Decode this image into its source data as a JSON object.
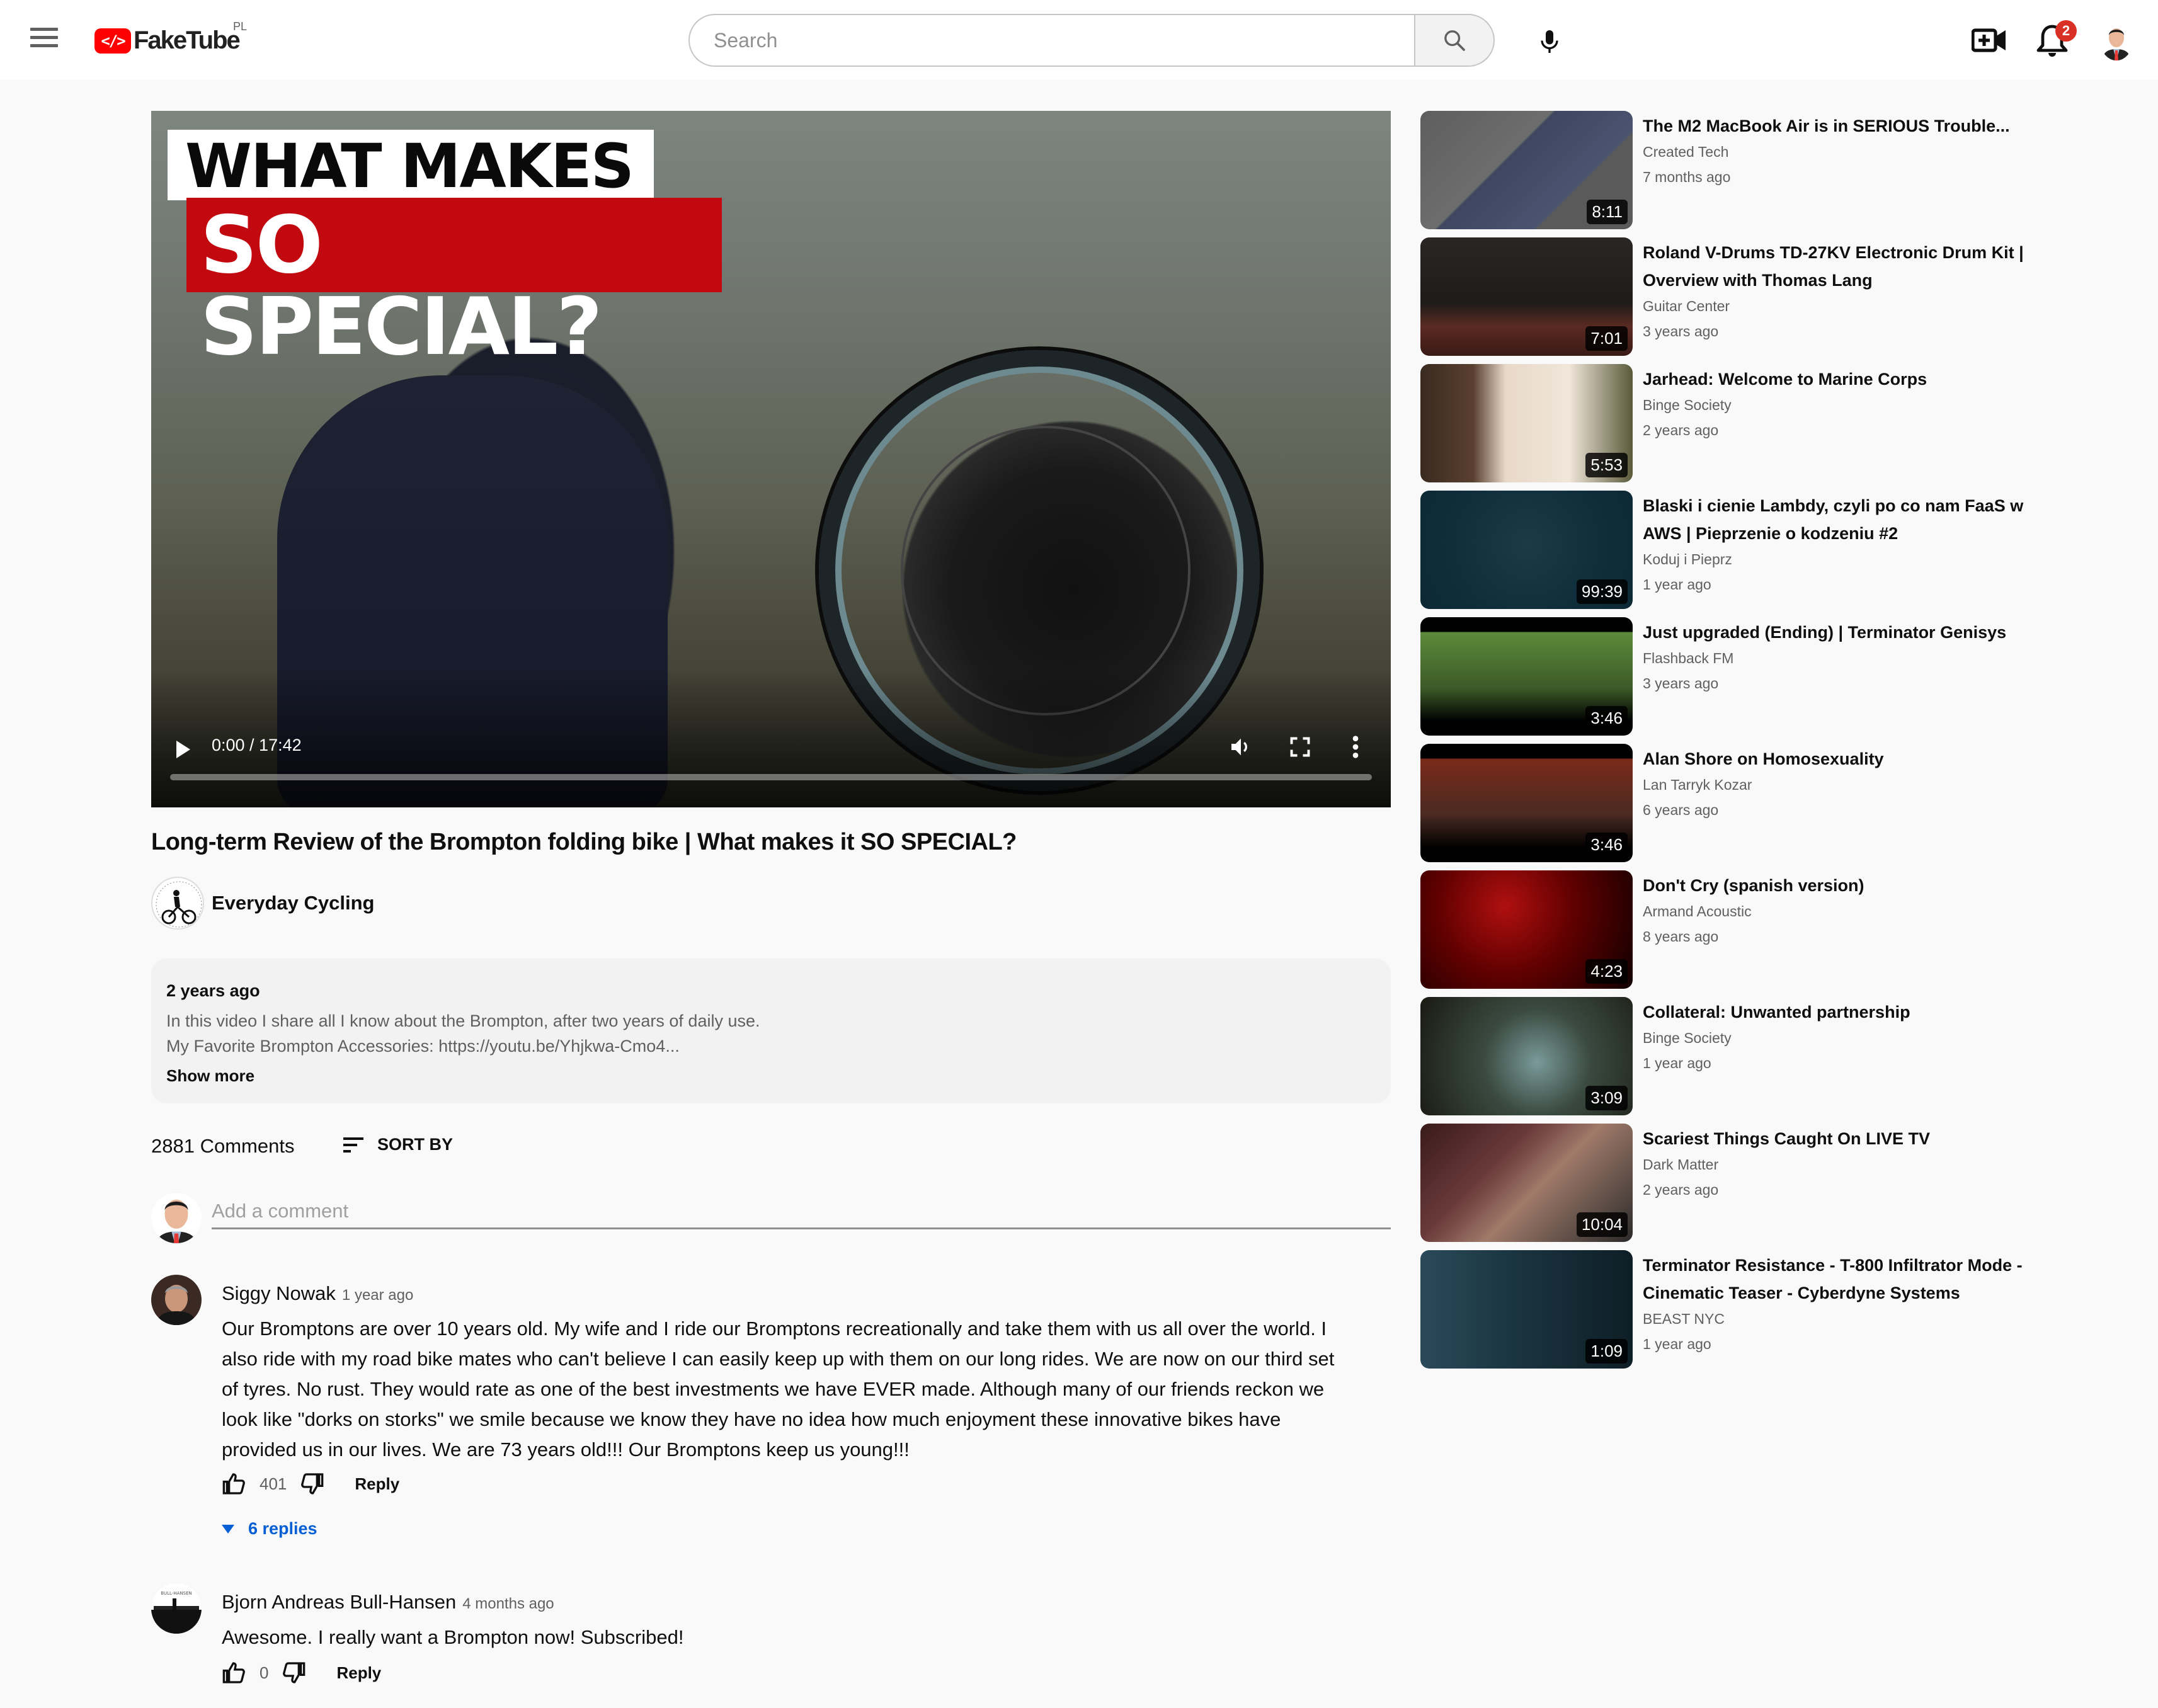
{
  "header": {
    "app_name": "FakeTube",
    "country_code": "PL",
    "search_placeholder": "Search",
    "search_value": "",
    "notification_count": "2"
  },
  "player": {
    "thumbnail_line1": "WHAT MAKES IT",
    "thumbnail_line2": "SO SPECIAL?",
    "time_display": "0:00 / 17:42",
    "progress_fraction": 0
  },
  "video": {
    "title": "Long-term Review of the Brompton folding bike | What makes it SO SPECIAL?",
    "channel_name": "Everyday Cycling"
  },
  "description": {
    "date": "2 years ago",
    "line1": "In this video I share all I know about the Brompton, after two years of daily use.",
    "line2": "My Favorite Brompton Accessories: https://youtu.be/Yhjkwa-Cmo4...",
    "show_more": "Show more"
  },
  "comments_header": {
    "count_label": "2881 Comments",
    "sort_label": "SORT BY",
    "add_placeholder": "Add a comment"
  },
  "comments": [
    {
      "author": "Siggy Nowak",
      "time": "1 year ago",
      "text": "Our Bromptons are over 10 years old. My wife and I ride our Bromptons recreationally and take them with us all over the world. I also ride with my road bike mates who can't believe I can easily keep up with them on our long rides. We are now on our third set of tyres. No rust. They would rate as one of the best investments we have EVER made. Although many of our friends reckon we look like \"dorks on storks\" we smile because we know they have no idea how much enjoyment these innovative bikes have provided us in our lives. We are 73 years old!!! Our Bromptons keep us young!!!",
      "likes": "401",
      "reply_label": "Reply",
      "replies_label": "6 replies"
    },
    {
      "author": "Bjorn Andreas Bull-Hansen",
      "time": "4 months ago",
      "text": "Awesome. I really want a Brompton now! Subscribed!",
      "likes": "0",
      "reply_label": "Reply"
    }
  ],
  "sidebar": [
    {
      "title": "The M2 MacBook Air is in SERIOUS Trouble...",
      "channel": "Created Tech",
      "age": "7 months ago",
      "duration": "8:11"
    },
    {
      "title": "Roland V-Drums TD-27KV Electronic Drum Kit | Overview with Thomas Lang",
      "channel": "Guitar Center",
      "age": "3 years ago",
      "duration": "7:01"
    },
    {
      "title": "Jarhead: Welcome to Marine Corps",
      "channel": "Binge Society",
      "age": "2 years ago",
      "duration": "5:53"
    },
    {
      "title": "Blaski i cienie Lambdy, czyli po co nam FaaS w AWS | Pieprzenie o kodzeniu #2",
      "channel": "Koduj i Pieprz",
      "age": "1 year ago",
      "duration": "99:39"
    },
    {
      "title": "Just upgraded (Ending) | Terminator Genisys",
      "channel": "Flashback FM",
      "age": "3 years ago",
      "duration": "3:46"
    },
    {
      "title": "Alan Shore on Homosexuality",
      "channel": "Lan Tarryk Kozar",
      "age": "6 years ago",
      "duration": "3:46"
    },
    {
      "title": "Don't Cry (spanish version)",
      "channel": "Armand Acoustic",
      "age": "8 years ago",
      "duration": "4:23"
    },
    {
      "title": "Collateral: Unwanted partnership",
      "channel": "Binge Society",
      "age": "1 year ago",
      "duration": "3:09"
    },
    {
      "title": "Scariest Things Caught On LIVE TV",
      "channel": "Dark Matter",
      "age": "2 years ago",
      "duration": "10:04"
    },
    {
      "title": "Terminator Resistance - T-800 Infiltrator Mode - Cinematic Teaser - Cyberdyne Systems",
      "channel": "BEAST NYC",
      "age": "1 year ago",
      "duration": "1:09"
    }
  ],
  "colors": {
    "brand_red": "#ff0000",
    "link_blue": "#065fd4",
    "badge_red": "#d93025"
  }
}
